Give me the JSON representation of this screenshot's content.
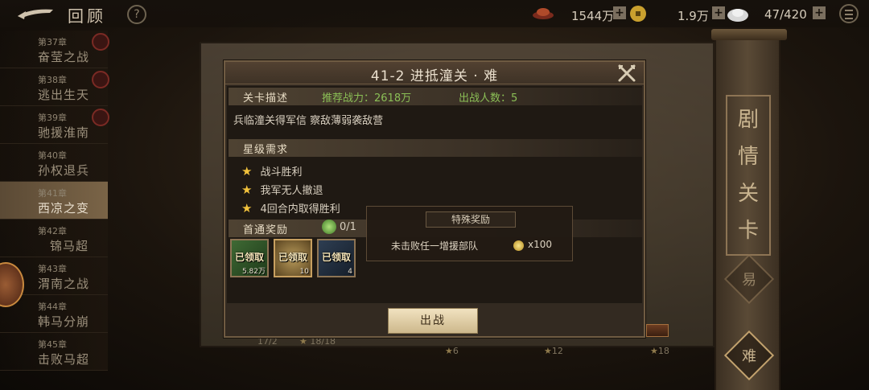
{
  "topbar": {
    "title": "回顾",
    "help_label": "?",
    "resource_1": "1544万",
    "resource_2": "1.9万",
    "resource_3": "47/420",
    "plus": "+"
  },
  "chapters": [
    {
      "num": "第37章",
      "name": "奋莹之战"
    },
    {
      "num": "第38章",
      "name": "逃出生天"
    },
    {
      "num": "第39章",
      "name": "驰援淮南"
    },
    {
      "num": "第40章",
      "name": "孙权退兵"
    },
    {
      "num": "第41章",
      "name": "西凉之变"
    },
    {
      "num": "第42章",
      "name": "锦马超"
    },
    {
      "num": "第43章",
      "name": "渭南之战"
    },
    {
      "num": "第44章",
      "name": "韩马分崩"
    },
    {
      "num": "第45章",
      "name": "击败马超"
    }
  ],
  "dialog": {
    "title": "41-2 进抵潼关 · 难",
    "stage_desc_label": "关卡描述",
    "power_text": "推荐战力：2618万",
    "fighters_text": "出战人数：5",
    "description": "兵临潼关得军信 察敌薄弱袭敌营",
    "star_label": "星级需求",
    "requirements": [
      "战斗胜利",
      "我军无人撤退",
      "4回合内取得胜利"
    ],
    "star_glyph": "★",
    "first_clear_label": "首通奖励",
    "first_clear_count": "0/1",
    "rewards": [
      {
        "status": "已领取",
        "qty": "5.82万"
      },
      {
        "status": "已领取",
        "qty": "10"
      },
      {
        "status": "已领取",
        "qty": "4"
      }
    ],
    "battle_button": "出战"
  },
  "tooltip": {
    "title": "特殊奖励",
    "text": "未击败任一增援部队",
    "qty": "x100"
  },
  "scroll": {
    "title_chars": [
      "剧",
      "情",
      "关",
      "卡"
    ],
    "easy": "易",
    "hard": "难"
  },
  "progress": {
    "p1": "17/2",
    "p2": "18/18",
    "p3": "6",
    "p4": "12",
    "p5": "18"
  },
  "colors": {
    "accent_green": "#8bbf56",
    "star_gold": "#f2c23c",
    "panel": "#332a21"
  }
}
